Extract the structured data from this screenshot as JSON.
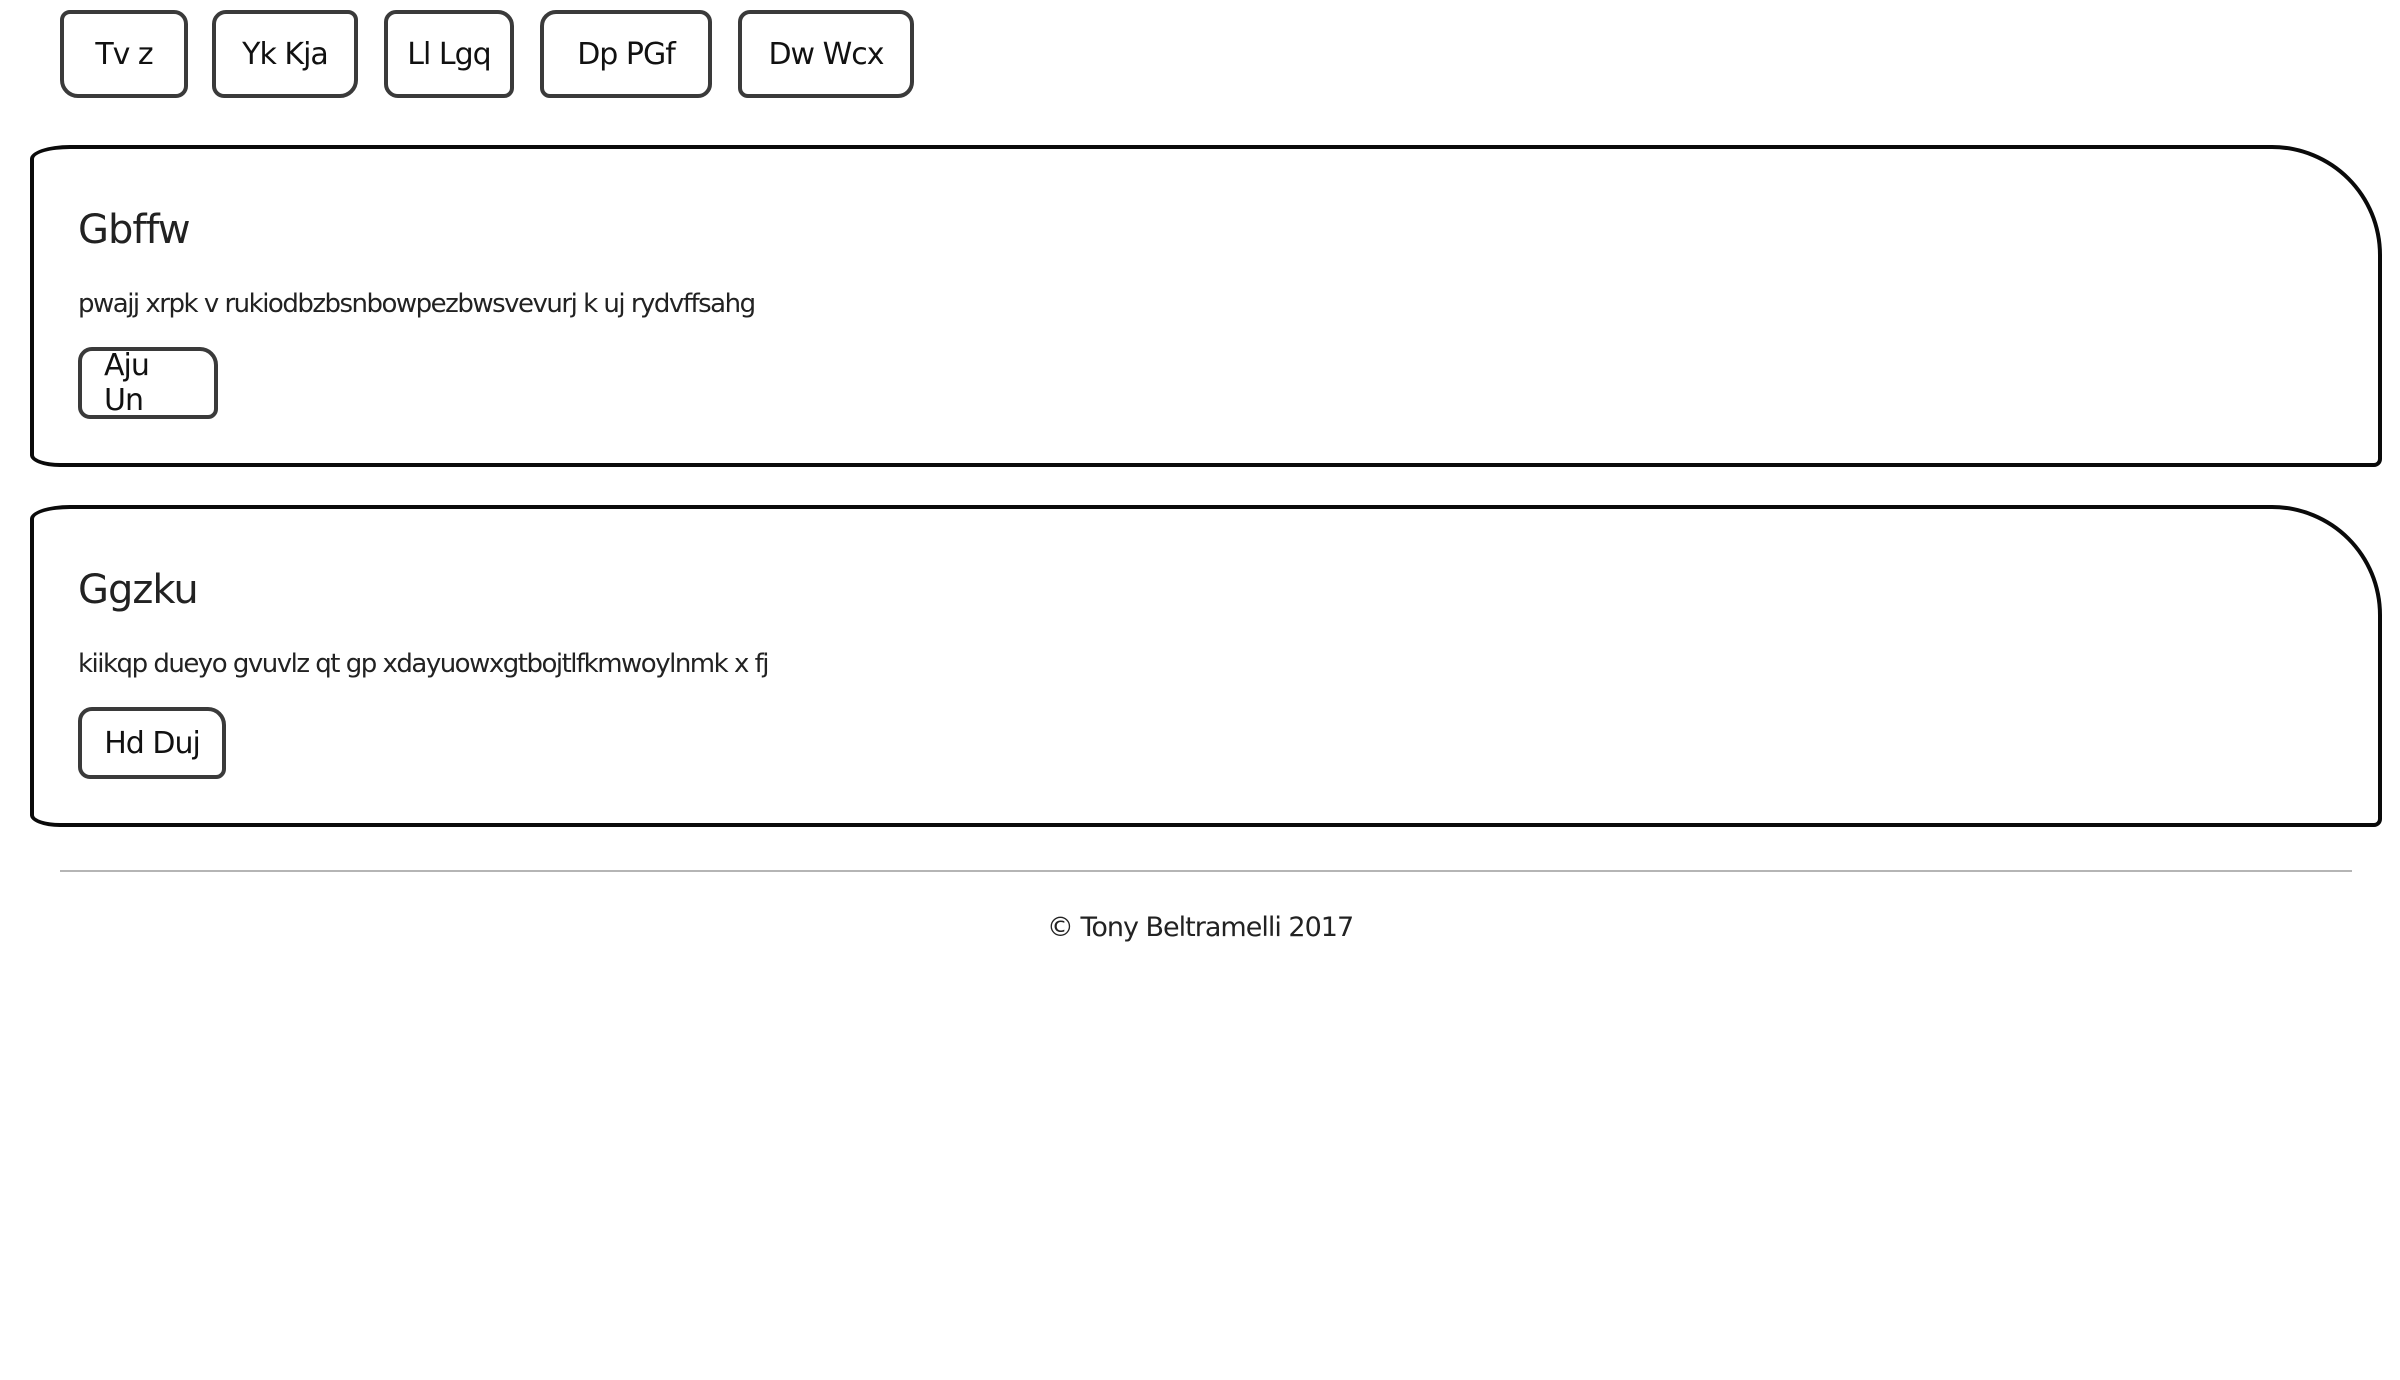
{
  "nav": {
    "items": [
      {
        "label": "Tv z"
      },
      {
        "label": "Yk Kja"
      },
      {
        "label": "Ll Lgq"
      },
      {
        "label": "Dp PGf"
      },
      {
        "label": "Dw Wcx"
      }
    ]
  },
  "cards": [
    {
      "title": "Gbffw",
      "text": "pwajj xrpk v rukiodbzbsnbowpezbwsvevurj k uj rydvffsahg",
      "button": "Aju Un"
    },
    {
      "title": "Ggzku",
      "text": "kiikqp dueyo gvuvlz qt gp xdayuowxgtbojtlfkmwoylnmk x fj",
      "button": "Hd Duj"
    }
  ],
  "footer": {
    "copyright": "© Tony Beltramelli 2017"
  },
  "colors": {
    "border": "#3a3a3a",
    "card_border": "#0a0a0a",
    "divider": "#b5b5b5",
    "background": "#ffffff"
  }
}
